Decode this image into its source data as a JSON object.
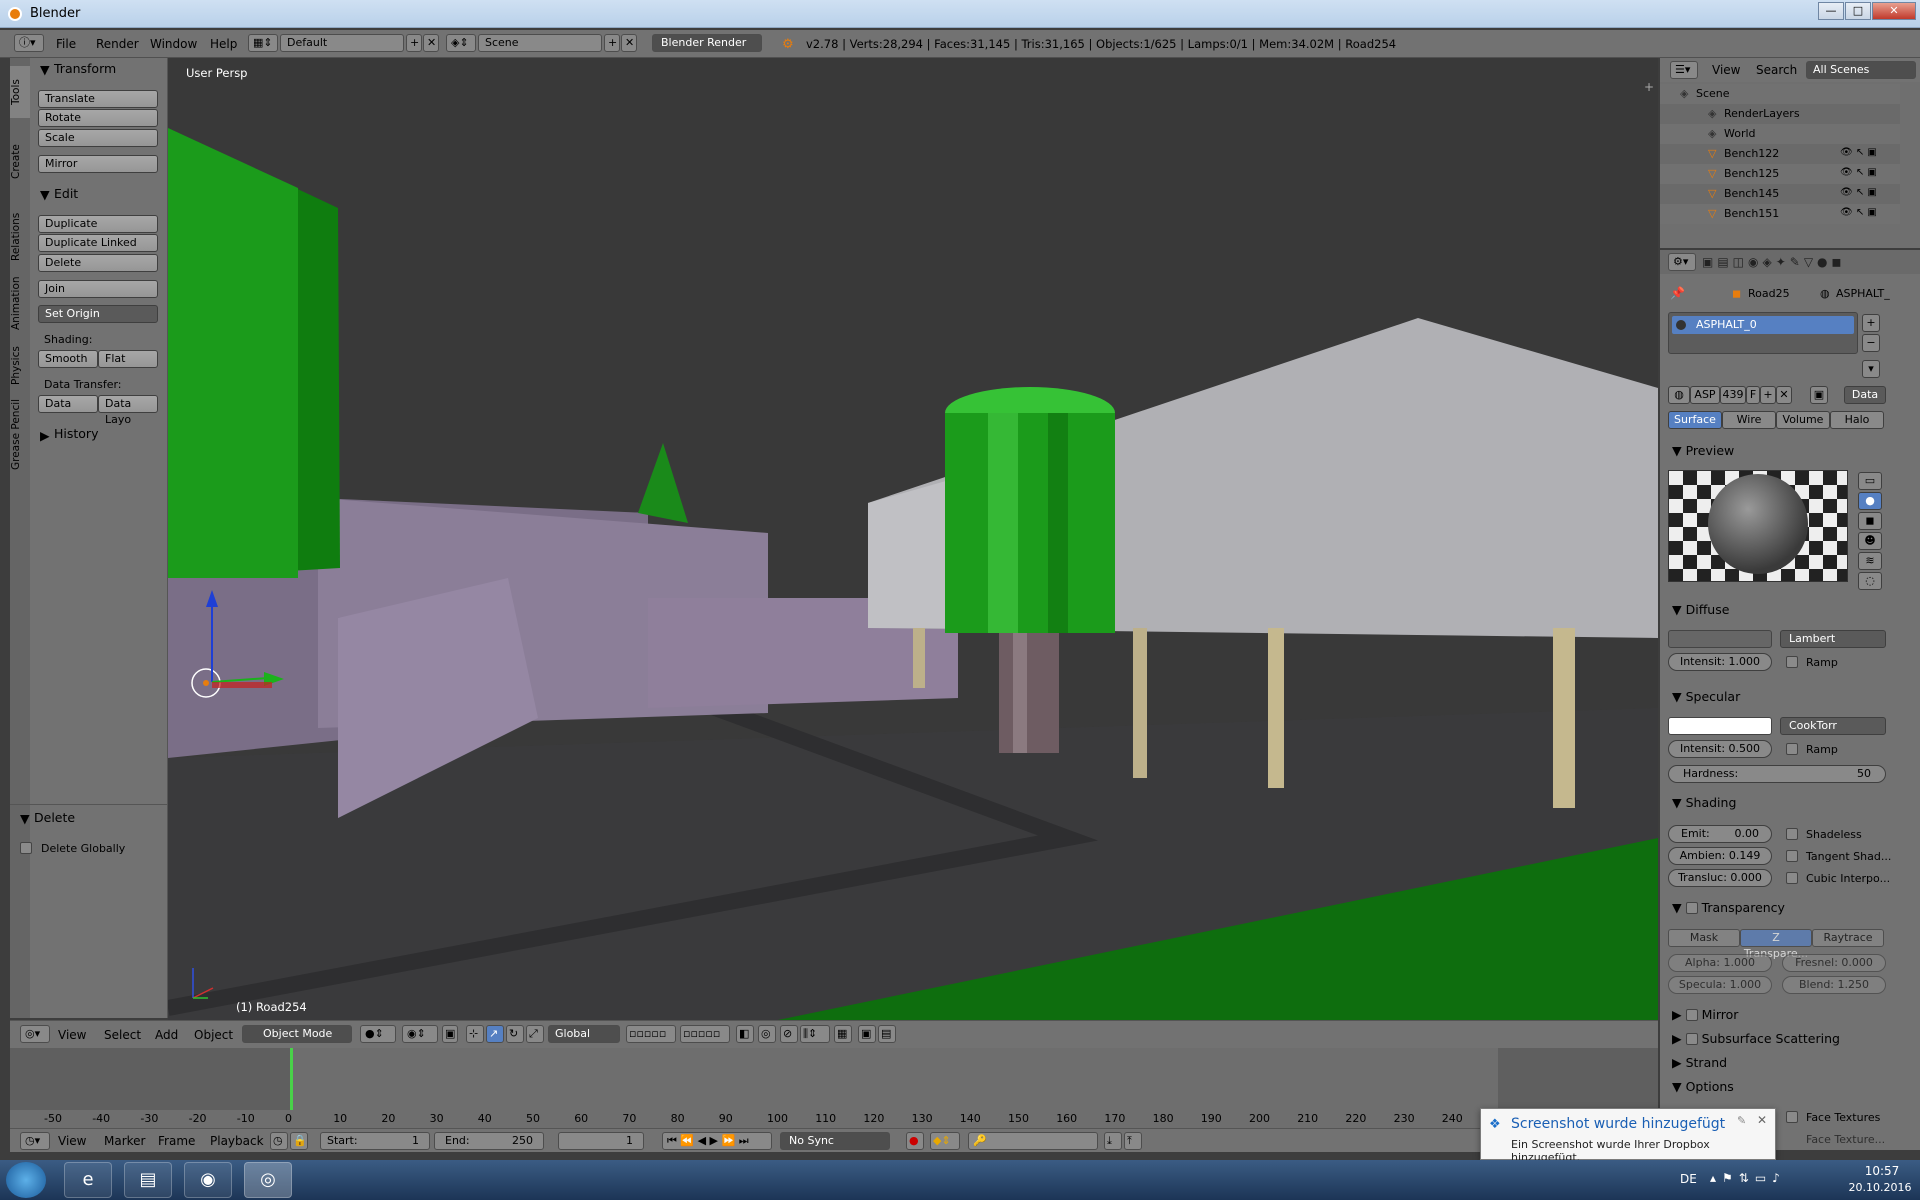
{
  "window": {
    "title": "Blender",
    "min_label": "—",
    "max_label": "□",
    "close_label": "✕"
  },
  "topmenu": {
    "items": [
      "File",
      "Render",
      "Window",
      "Help"
    ],
    "layout": "Default",
    "scene": "Scene",
    "engine": "Blender Render",
    "stats": "v2.78 | Verts:28,294 | Faces:31,145 | Tris:31,165 | Objects:1/625 | Lamps:0/1 | Mem:34.02M | Road254"
  },
  "toolshelf": {
    "tabs": [
      "Tools",
      "Create",
      "Relations",
      "Animation",
      "Physics",
      "Grease Pencil"
    ],
    "transform_header": "Transform",
    "transform_buttons": [
      "Translate",
      "Rotate",
      "Scale"
    ],
    "mirror": "Mirror",
    "edit_header": "Edit",
    "edit_buttons": [
      "Duplicate",
      "Duplicate Linked",
      "Delete"
    ],
    "join": "Join",
    "set_origin": "Set Origin",
    "shading_label": "Shading:",
    "smooth": "Smooth",
    "flat": "Flat",
    "data_transfer_label": "Data Transfer:",
    "data": "Data",
    "data_layout": "Data Layo",
    "history": "History",
    "delete_header": "Delete",
    "delete_globally": "Delete Globally"
  },
  "viewport": {
    "view_label": "User Persp",
    "object_label": "(1) Road254",
    "colors": {
      "green": "#1a8a1a",
      "lavender": "#8c7d99",
      "gray_building": "#a8a8ac",
      "trunk": "#6a5a5e"
    }
  },
  "viewheader": {
    "menus": [
      "View",
      "Select",
      "Add",
      "Object"
    ],
    "mode": "Object Mode",
    "orientation": "Global"
  },
  "timeline": {
    "ticks": [
      "-50",
      "-40",
      "-30",
      "-20",
      "-10",
      "0",
      "10",
      "20",
      "30",
      "40",
      "50",
      "60",
      "70",
      "80",
      "90",
      "100",
      "110",
      "120",
      "130",
      "140",
      "150",
      "160",
      "170",
      "180",
      "190",
      "200",
      "210",
      "220",
      "230",
      "240"
    ],
    "menus": [
      "View",
      "Marker",
      "Frame",
      "Playback"
    ],
    "start_label": "Start:",
    "start": "1",
    "end_label": "End:",
    "end": "250",
    "current": "1",
    "sync": "No Sync"
  },
  "outliner": {
    "menus": [
      "View",
      "Search"
    ],
    "filter": "All Scenes",
    "rows": [
      {
        "name": "Scene",
        "indent": 0
      },
      {
        "name": "RenderLayers",
        "indent": 1
      },
      {
        "name": "World",
        "indent": 1
      },
      {
        "name": "Bench122",
        "indent": 1
      },
      {
        "name": "Bench125",
        "indent": 1
      },
      {
        "name": "Bench145",
        "indent": 1
      },
      {
        "name": "Bench151",
        "indent": 1
      }
    ]
  },
  "properties": {
    "breadcrumb_object": "Road25",
    "breadcrumb_material": "ASPHALT_",
    "material_slot": "ASPHALT_0",
    "material_short": "ASP",
    "users": "439",
    "fake": "F",
    "data": "Data",
    "tabs": [
      "Surface",
      "Wire",
      "Volume",
      "Halo"
    ],
    "preview": "Preview",
    "diffuse": "Diffuse",
    "diffuse_shader": "Lambert",
    "diffuse_intensity": "Intensit: 1.000",
    "ramp": "Ramp",
    "specular": "Specular",
    "specular_shader": "CookTorr",
    "specular_intensity": "Intensit: 0.500",
    "hardness_label": "Hardness:",
    "hardness": "50",
    "shading": "Shading",
    "emit": "Emit:",
    "emit_value": "0.00",
    "ambient": "Ambien: 0.149",
    "transluc": "Transluc: 0.000",
    "shadeless": "Shadeless",
    "tangent": "Tangent Shad...",
    "cubic": "Cubic Interpo...",
    "transparency": "Transparency",
    "trans_tabs": [
      "Mask",
      "Z Transpare...",
      "Raytrace"
    ],
    "alpha": "Alpha:   1.000",
    "fresnel": "Fresnel: 0.000",
    "specula": "Specula: 1.000",
    "blend": "Blend:   1.250",
    "mirror": "Mirror",
    "sss": "Subsurface Scattering",
    "strand": "Strand",
    "options": "Options",
    "face_textures": "Face Textures",
    "face_texture2": "Face Texture..."
  },
  "toast": {
    "title": "Screenshot wurde hinzugefügt",
    "body": "Ein Screenshot wurde Ihrer Dropbox hinzugefügt."
  },
  "taskbar": {
    "lang": "DE",
    "time": "10:57",
    "date": "20.10.2016"
  }
}
